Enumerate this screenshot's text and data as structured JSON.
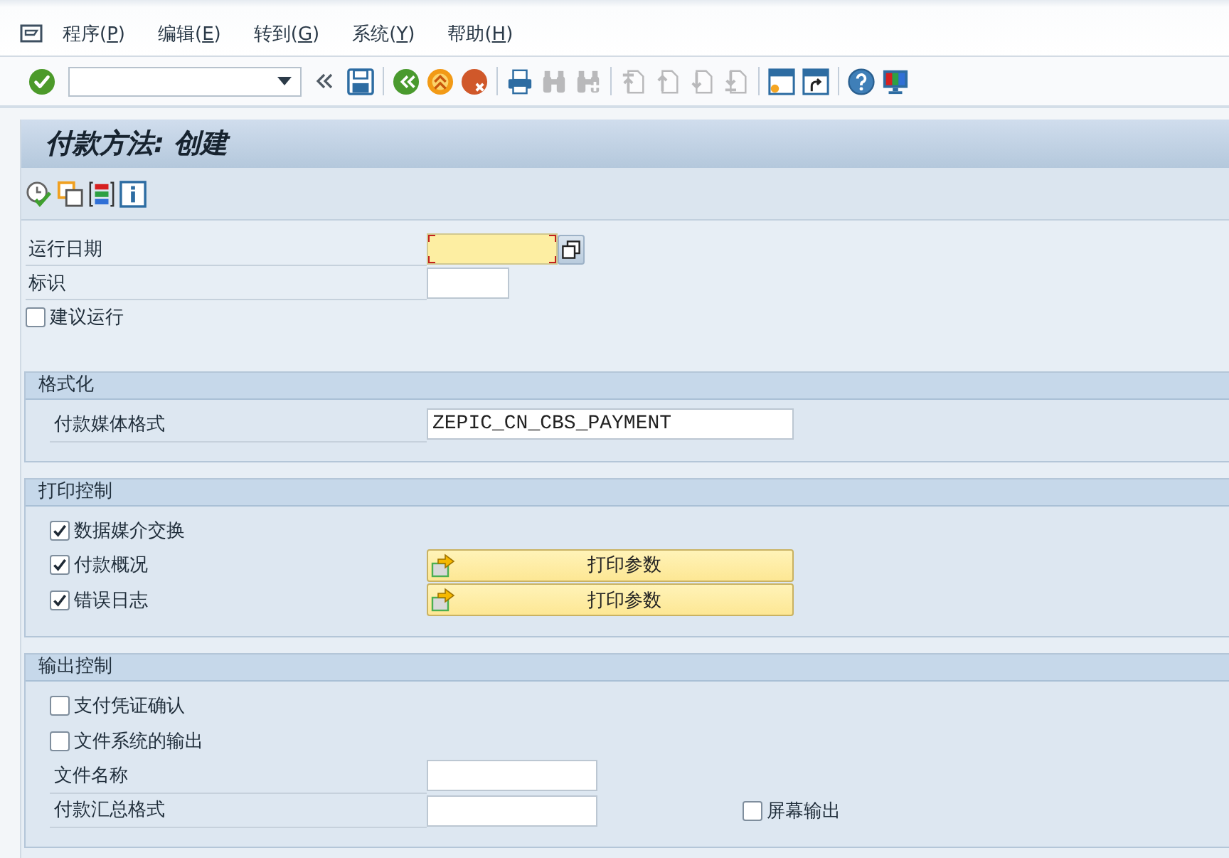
{
  "menu_bar": {
    "items": [
      {
        "before": "程序(",
        "mnemonic": "P",
        "after": ")"
      },
      {
        "before": "编辑(",
        "mnemonic": "E",
        "after": ")"
      },
      {
        "before": "转到(",
        "mnemonic": "G",
        "after": ")"
      },
      {
        "before": "系统(",
        "mnemonic": "Y",
        "after": ")"
      },
      {
        "before": "帮助(",
        "mnemonic": "H",
        "after": ")"
      }
    ]
  },
  "toolbar": {
    "groups": [
      [
        {
          "kind": "enter",
          "disabled": false
        },
        {
          "kind": "command_field",
          "disabled": false
        },
        {
          "kind": "collapse",
          "disabled": false
        },
        {
          "kind": "save",
          "disabled": false
        }
      ],
      [
        {
          "kind": "back",
          "disabled": false
        },
        {
          "kind": "exit",
          "disabled": false
        },
        {
          "kind": "cancel",
          "disabled": false
        }
      ],
      [
        {
          "kind": "print",
          "disabled": false
        },
        {
          "kind": "find",
          "disabled": true
        },
        {
          "kind": "find_next",
          "disabled": true
        }
      ],
      [
        {
          "kind": "first_page",
          "disabled": true
        },
        {
          "kind": "previous_page",
          "disabled": true
        },
        {
          "kind": "next_page",
          "disabled": true
        },
        {
          "kind": "last_page",
          "disabled": true
        }
      ],
      [
        {
          "kind": "new_session",
          "disabled": false
        },
        {
          "kind": "shortcut",
          "disabled": false
        }
      ],
      [
        {
          "kind": "help",
          "disabled": false
        },
        {
          "kind": "layout",
          "disabled": false
        }
      ]
    ]
  },
  "screen": {
    "title": "付款方法: 创建",
    "app_toolbar": [
      {
        "kind": "execute"
      },
      {
        "kind": "copy"
      },
      {
        "kind": "colors"
      },
      {
        "kind": "info"
      }
    ]
  },
  "parameters": [
    {
      "kind": "input",
      "label": "运行日期",
      "required": true,
      "focused": true,
      "value_help": true
    },
    {
      "kind": "input",
      "label": "标识",
      "required": false,
      "focused": false,
      "value_help": false
    },
    {
      "kind": "checkbox",
      "label": "建议运行",
      "checked": false
    }
  ],
  "sections": [
    {
      "title": "格式化",
      "rows": [
        {
          "kind": "input",
          "label": "付款媒体格式",
          "value": "ZEPIC_CN_CBS_PAYMENT",
          "required": false,
          "focused": false,
          "value_help": false
        }
      ]
    },
    {
      "title": "打印控制",
      "rows": [
        {
          "kind": "checkbox",
          "label": "数据媒介交换",
          "checked": true
        },
        {
          "kind": "checkbox",
          "label": "付款概况",
          "checked": true,
          "button": "打印参数"
        },
        {
          "kind": "checkbox",
          "label": "错误日志",
          "checked": true,
          "button": "打印参数"
        }
      ]
    },
    {
      "title": "输出控制",
      "rows": [
        {
          "kind": "checkbox",
          "label": "支付凭证确认",
          "checked": false
        },
        {
          "kind": "checkbox",
          "label": "文件系统的输出",
          "checked": false
        },
        {
          "kind": "input",
          "label": "文件名称",
          "required": false,
          "focused": false,
          "value_help": false
        },
        {
          "kind": "input",
          "label": "付款汇总格式",
          "required": false,
          "focused": false,
          "value_help": false,
          "side_checkbox": {
            "label": "屏幕输出",
            "checked": false
          }
        }
      ]
    }
  ]
}
